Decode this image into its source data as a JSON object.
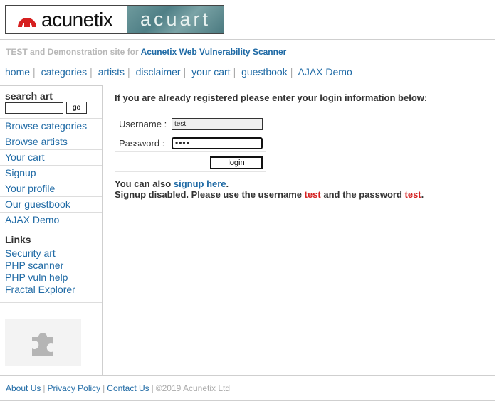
{
  "logo": {
    "brand": "acunetix",
    "site": "acuart"
  },
  "tagline": {
    "prefix": "TEST and Demonstration site for",
    "link": "Acunetix Web Vulnerability Scanner"
  },
  "topnav": [
    "home",
    "categories",
    "artists",
    "disclaimer",
    "your cart",
    "guestbook",
    "AJAX Demo"
  ],
  "sidebar": {
    "search_title": "search art",
    "search_value": "",
    "go_label": "go",
    "menu": [
      "Browse categories",
      "Browse artists",
      "Your cart",
      "Signup",
      "Your profile",
      "Our guestbook",
      "AJAX Demo"
    ],
    "links_title": "Links",
    "links": [
      "Security art",
      "PHP scanner",
      "PHP vuln help",
      "Fractal Explorer"
    ]
  },
  "login": {
    "intro": "If you are already registered please enter your login information below:",
    "username_label": "Username :",
    "username_value": "test",
    "password_label": "Password :",
    "password_mask": "••••",
    "button": "login"
  },
  "message": {
    "line1_prefix": "You can also",
    "line1_link": "signup here",
    "line1_suffix": ".",
    "line2_a": "Signup disabled. Please use the username",
    "line2_user": "test",
    "line2_b": "and the password",
    "line2_pass": "test",
    "line2_end": "."
  },
  "footer": {
    "about": "About Us",
    "privacy": "Privacy Policy",
    "contact": "Contact Us",
    "copyright": "©2019 Acunetix Ltd"
  },
  "colors": {
    "link": "#1f6aa5",
    "red": "#d42121",
    "logo_red": "#d62020"
  },
  "icons": [
    "acunetix-logo-icon",
    "puzzle-plugin-icon"
  ]
}
